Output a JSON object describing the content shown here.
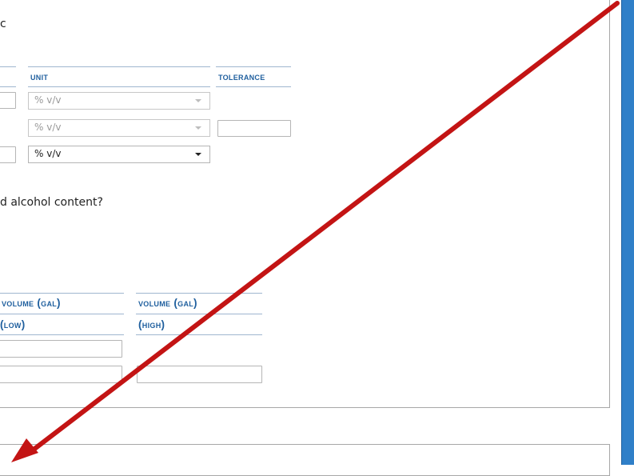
{
  "form": {
    "intro_fragment": "c",
    "abv_table": {
      "headers": {
        "unit": "Unit",
        "tolerance": "Tolerance"
      },
      "rows": [
        {
          "unit": "% v/v",
          "unit_state": "disabled"
        },
        {
          "unit": "% v/v",
          "unit_state": "disabled"
        },
        {
          "unit": "% v/v",
          "unit_state": "active"
        }
      ]
    },
    "question_fragment": "d alcohol content?",
    "volume_table": {
      "headers": {
        "low_line1": "Volume (gal)",
        "low_line2": "(low)",
        "high_line1": "Volume (gal)",
        "high_line2": "(high)"
      }
    }
  },
  "annotation": {
    "arrow_color": "#c31414"
  },
  "colors": {
    "header_text": "#1f5f9e",
    "side_bar": "#2f7fc8"
  }
}
